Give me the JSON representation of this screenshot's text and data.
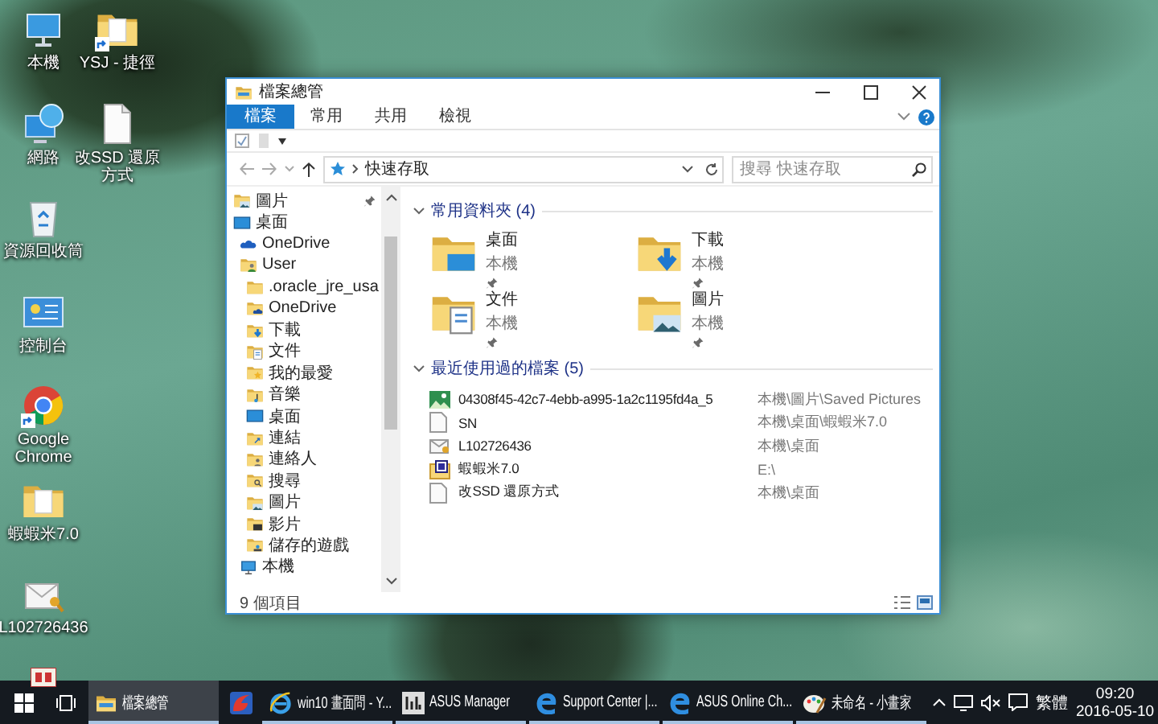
{
  "desktop": {
    "icons": [
      {
        "label": "本機",
        "kind": "computer",
        "shortcut": false
      },
      {
        "label": "網路",
        "kind": "network",
        "shortcut": false
      },
      {
        "label": "資源回收筒",
        "kind": "recycle-bin",
        "shortcut": false
      },
      {
        "label": "控制台",
        "kind": "control-panel",
        "shortcut": false
      },
      {
        "label": "Google Chrome",
        "kind": "chrome",
        "shortcut": true
      },
      {
        "label": "蝦蝦米7.0",
        "kind": "folder",
        "shortcut": false
      },
      {
        "label": "L102726436",
        "kind": "certificate",
        "shortcut": false
      },
      {
        "label": "YSJ - 捷徑",
        "kind": "folder",
        "shortcut": true
      },
      {
        "label": "改SSD 還原方式",
        "kind": "document",
        "shortcut": false
      }
    ]
  },
  "window": {
    "title": "檔案總管",
    "ribbon_tabs": [
      {
        "label": "檔案",
        "selected": true
      },
      {
        "label": "常用",
        "selected": false
      },
      {
        "label": "共用",
        "selected": false
      },
      {
        "label": "檢視",
        "selected": false
      }
    ],
    "address": {
      "path": "快速存取"
    },
    "search": {
      "placeholder": "搜尋 快速存取"
    },
    "navigation": [
      {
        "label": "圖片",
        "kind": "pictures",
        "pinned": true
      },
      {
        "label": "桌面",
        "kind": "desktop",
        "pinned": false,
        "children": [
          {
            "label": "OneDrive",
            "kind": "onedrive",
            "pinned": false
          },
          {
            "label": "User",
            "kind": "user",
            "pinned": false,
            "children": [
              {
                "label": ".oracle_jre_usa",
                "kind": "plain",
                "pinned": false
              },
              {
                "label": "OneDrive",
                "kind": "onedrive-folder",
                "pinned": false
              },
              {
                "label": "下載",
                "kind": "downloads",
                "pinned": false
              },
              {
                "label": "文件",
                "kind": "documents",
                "pinned": false
              },
              {
                "label": "我的最愛",
                "kind": "favorites",
                "pinned": false
              },
              {
                "label": "音樂",
                "kind": "music",
                "pinned": false
              },
              {
                "label": "桌面",
                "kind": "desktop",
                "pinned": false
              },
              {
                "label": "連結",
                "kind": "links",
                "pinned": false
              },
              {
                "label": "連絡人",
                "kind": "contacts",
                "pinned": false
              },
              {
                "label": "搜尋",
                "kind": "search",
                "pinned": false
              },
              {
                "label": "圖片",
                "kind": "pictures",
                "pinned": false
              },
              {
                "label": "影片",
                "kind": "videos",
                "pinned": false
              },
              {
                "label": "儲存的遊戲",
                "kind": "games",
                "pinned": false
              }
            ]
          },
          {
            "label": "本機",
            "kind": "computer",
            "pinned": false
          }
        ]
      }
    ],
    "sections": [
      {
        "title": "常用資料夾 (4)",
        "kind": "tiles",
        "items": [
          {
            "name": "桌面",
            "location": "本機",
            "kind": "desktop",
            "pinned": true
          },
          {
            "name": "下載",
            "location": "本機",
            "kind": "downloads",
            "pinned": true
          },
          {
            "name": "文件",
            "location": "本機",
            "kind": "documents",
            "pinned": true
          },
          {
            "name": "圖片",
            "location": "本機",
            "kind": "pictures",
            "pinned": true
          }
        ]
      },
      {
        "title": "最近使用過的檔案 (5)",
        "kind": "list",
        "items": [
          {
            "name": "04308f45-42c7-4ebb-a995-1a2c1195fd4a_5",
            "location": "本機\\圖片\\Saved Pictures",
            "kind": "image"
          },
          {
            "name": "SN",
            "location": "本機\\桌面\\蝦蝦米7.0",
            "kind": "document"
          },
          {
            "name": "L102726436",
            "location": "本機\\桌面",
            "kind": "certificate"
          },
          {
            "name": "蝦蝦米7.0",
            "location": "E:\\",
            "kind": "app"
          },
          {
            "name": "改SSD 還原方式",
            "location": "本機\\桌面",
            "kind": "document"
          }
        ]
      }
    ],
    "status_bar": {
      "item_count": "9 個項目"
    }
  },
  "taskbar": {
    "buttons": [
      {
        "label": "檔案總管",
        "kind": "explorer",
        "selected": true,
        "running": true
      },
      {
        "kind": "red-browser",
        "selected": false,
        "running": false
      },
      {
        "label": "win10 畫面問 - Y...",
        "kind": "ie",
        "selected": false,
        "running": true
      },
      {
        "label": "ASUS Manager",
        "kind": "asus",
        "selected": false,
        "running": true
      },
      {
        "label": "Support Center |...",
        "kind": "edge",
        "selected": false,
        "running": true
      },
      {
        "label": "ASUS Online Ch...",
        "kind": "edge",
        "selected": false,
        "running": true
      },
      {
        "label": "未命名 - 小畫家",
        "kind": "paint",
        "selected": false,
        "running": true
      }
    ],
    "language": "繁體",
    "time": "09:20",
    "date": "2016-05-10"
  }
}
